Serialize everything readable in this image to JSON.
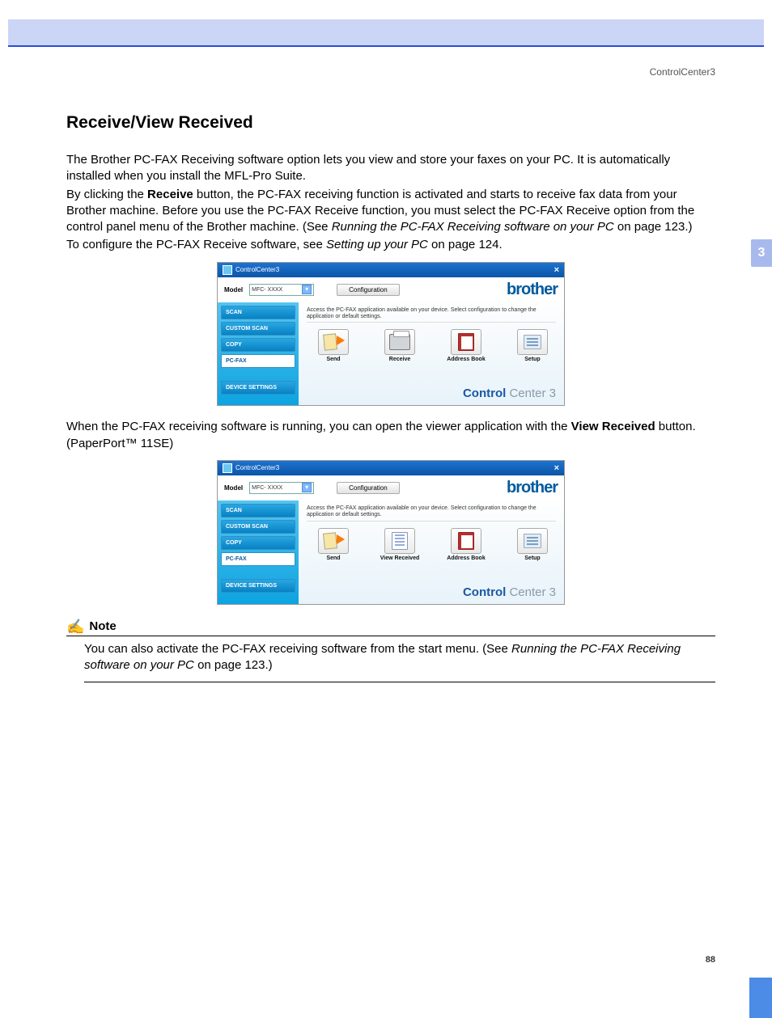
{
  "doc": {
    "header": "ControlCenter3",
    "chapter": "3",
    "pageNumber": "88"
  },
  "section": {
    "title": "Receive/View Received",
    "p1": "The Brother PC-FAX Receiving software option lets you view and store your faxes on your PC. It is automatically installed when you install the MFL-Pro Suite.",
    "p2a": "By clicking the ",
    "p2b": "Receive",
    "p2c": " button, the PC-FAX receiving function is activated and starts to receive fax data from your Brother machine. Before you use the PC-FAX Receive function, you must select the PC-FAX Receive option from the control panel menu of the Brother machine. (See ",
    "p2d": "Running the PC-FAX Receiving software on your PC",
    "p2e": " on page 123.)",
    "p3a": "To configure the PC-FAX Receive software, see ",
    "p3b": "Setting up your PC",
    "p3c": " on page 124.",
    "p4a": "When the PC-FAX receiving software is running, you can open the viewer application with the ",
    "p4b": "View Received",
    "p4c": " button. (PaperPort™ 11SE)"
  },
  "note": {
    "label": "Note",
    "t1": "You can also activate the PC-FAX receiving software from the start menu. (See ",
    "t2": "Running the PC-FAX Receiving software on your PC",
    "t3": " on page 123.)"
  },
  "cc": {
    "title": "ControlCenter3",
    "close": "×",
    "modelLabel": "Model",
    "modelValue": "MFC- XXXX",
    "config": "Configuration",
    "brand": "brother",
    "desc": "Access the PC-FAX application available on your device.  Select configuration to change the application or default settings.",
    "sidebar": [
      "SCAN",
      "CUSTOM SCAN",
      "COPY",
      "PC-FAX",
      "DEVICE SETTINGS"
    ],
    "icons1": [
      "Send",
      "Receive",
      "Address Book",
      "Setup"
    ],
    "icons2": [
      "Send",
      "View Received",
      "Address Book",
      "Setup"
    ],
    "footerBold": "Control",
    "footerRest": " Center 3"
  }
}
